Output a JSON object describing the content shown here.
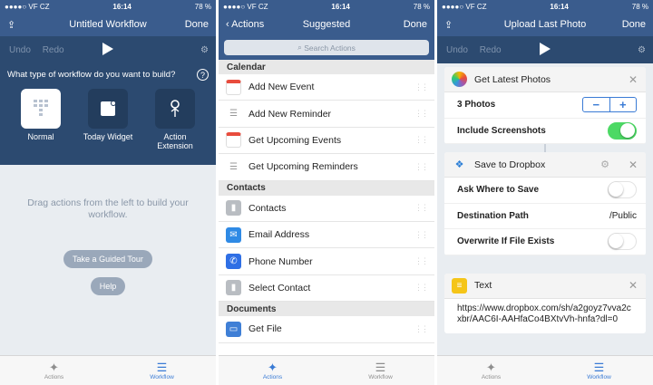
{
  "status": {
    "carrier": "●●●●○ VF CZ",
    "time": "16:14",
    "battery": "78 %"
  },
  "panel1": {
    "title": "Untitled Workflow",
    "done": "Done",
    "undo": "Undo",
    "redo": "Redo",
    "question": "What type of workflow do you want to build?",
    "types": [
      {
        "label": "Normal"
      },
      {
        "label": "Today Widget"
      },
      {
        "label": "Action Extension"
      }
    ],
    "hint": "Drag actions from the left to build your workflow.",
    "tour": "Take a Guided Tour",
    "help": "Help"
  },
  "panel2": {
    "back": "Actions",
    "title": "Suggested",
    "done": "Done",
    "search_placeholder": "Search Actions",
    "sections": [
      {
        "name": "Calendar",
        "items": [
          "Add New Event",
          "Add New Reminder",
          "Get Upcoming Events",
          "Get Upcoming Reminders"
        ]
      },
      {
        "name": "Contacts",
        "items": [
          "Contacts",
          "Email Address",
          "Phone Number",
          "Select Contact"
        ]
      },
      {
        "name": "Documents",
        "items": [
          "Get File"
        ]
      }
    ]
  },
  "panel3": {
    "title": "Upload Last Photo",
    "done": "Done",
    "undo": "Undo",
    "redo": "Redo",
    "card1": {
      "title": "Get Latest Photos",
      "count_label": "3 Photos",
      "screenshots_label": "Include Screenshots",
      "screenshots_on": true
    },
    "card2": {
      "title": "Save to Dropbox",
      "ask_label": "Ask Where to Save",
      "dest_label": "Destination Path",
      "dest_value": "/Public",
      "overwrite_label": "Overwrite If File Exists"
    },
    "card3": {
      "title": "Text",
      "body": "https://www.dropbox.com/sh/a2goyz7vva2cxbr/AAC6I-AAHfaCo4BXtvVh-hnfa?dl=0"
    }
  },
  "tabs": {
    "actions": "Actions",
    "workflow": "Workflow"
  },
  "colors": {
    "nav": "#3a5c8d",
    "accent": "#3a7bd5",
    "toggle_on": "#4cd964"
  }
}
